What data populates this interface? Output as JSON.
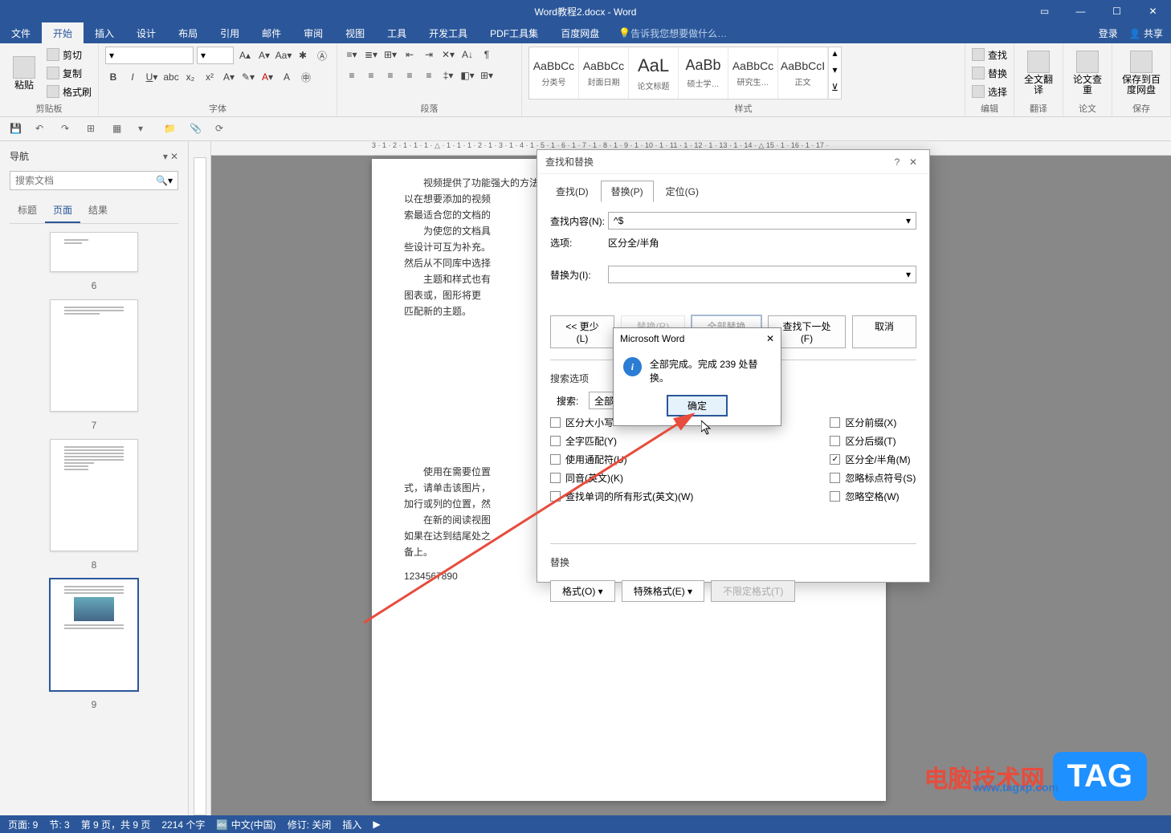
{
  "title": "Word教程2.docx - Word",
  "menu": {
    "file": "文件",
    "home": "开始",
    "insert": "插入",
    "design": "设计",
    "layout": "布局",
    "references": "引用",
    "mailings": "邮件",
    "review": "审阅",
    "view": "视图",
    "tools": "工具",
    "developer": "开发工具",
    "pdf": "PDF工具集",
    "baidu": "百度网盘",
    "tell": "告诉我您想要做什么…",
    "login": "登录",
    "share": "共享"
  },
  "ribbon": {
    "clipboard": {
      "paste": "粘贴",
      "cut": "剪切",
      "copy": "复制",
      "formatpainter": "格式刷",
      "label": "剪贴板"
    },
    "font": {
      "label": "字体"
    },
    "paragraph": {
      "label": "段落"
    },
    "styles": {
      "label": "样式",
      "items": [
        {
          "preview": "AaBbCc",
          "name": "分类号"
        },
        {
          "preview": "AaBbCc",
          "name": "封面日期"
        },
        {
          "preview": "AaL",
          "name": "论文标题"
        },
        {
          "preview": "AaBb",
          "name": "硕士学…"
        },
        {
          "preview": "AaBbCc",
          "name": "研究生…"
        },
        {
          "preview": "AaBbCcI",
          "name": "正文"
        }
      ]
    },
    "editing": {
      "find": "查找",
      "replace": "替换",
      "select": "选择",
      "label": "编辑"
    },
    "translate": {
      "full": "全文翻译",
      "label": "翻译"
    },
    "paper": {
      "btn": "论文查重",
      "label": "论文"
    },
    "save": {
      "btn": "保存到百度网盘",
      "label": "保存"
    }
  },
  "nav": {
    "title": "导航",
    "searchPlaceholder": "搜索文档",
    "tabs": {
      "headings": "标题",
      "pages": "页面",
      "results": "结果"
    },
    "thumbs": [
      "6",
      "7",
      "8",
      "9"
    ]
  },
  "doc": {
    "p1": "视频提供了功能强大的方法帮助您证明您的观点。当您单击联机视频时，可",
    "p2": "以在想要添加的视频",
    "p3": "索最适合您的文档的",
    "p4": "为使您的文档具",
    "p5": "些设计可互为补充。",
    "p6": "然后从不同库中选择",
    "p7": "主题和样式也有",
    "p8": "图表或，图形将更",
    "p9": "匹配新的主题。",
    "p10": "使用在需要位置",
    "p11": "式，请单击该图片，",
    "p12": "加行或列的位置，然",
    "p13": "在新的阅读视图",
    "p14": "如果在达到结尾处之",
    "p15": "备上。",
    "p16": "1234567890"
  },
  "dialog": {
    "title": "查找和替换",
    "tabs": {
      "find": "查找(D)",
      "replace": "替换(P)",
      "goto": "定位(G)"
    },
    "findLabel": "查找内容(N):",
    "findValue": "^$",
    "optionsLabel": "选项:",
    "optionsValue": "区分全/半角",
    "replaceLabel": "替换为(I):",
    "replaceValue": "",
    "less": "<< 更少(L)",
    "replaceBtn": "替换(R)",
    "replaceAll": "全部替换(A)",
    "findNext": "查找下一处(F)",
    "cancel": "取消",
    "searchOptions": "搜索选项",
    "searchLabel": "搜索:",
    "searchValue": "全部",
    "checks": {
      "left": [
        "区分大小写",
        "全字匹配(Y)",
        "使用通配符(U)",
        "同音(英文)(K)",
        "查找单词的所有形式(英文)(W)"
      ],
      "right": [
        "区分前缀(X)",
        "区分后缀(T)",
        "区分全/半角(M)",
        "忽略标点符号(S)",
        "忽略空格(W)"
      ]
    },
    "checkedRight": 2,
    "replaceSection": "替换",
    "format": "格式(O)",
    "special": "特殊格式(E)",
    "noformat": "不限定格式(T)"
  },
  "msgbox": {
    "title": "Microsoft Word",
    "text": "全部完成。完成 239 处替换。",
    "ok": "确定"
  },
  "status": {
    "page": "页面: 9",
    "section": "节: 3",
    "pages": "第 9 页，共 9 页",
    "words": "2214 个字",
    "lang": "中文(中国)",
    "track": "修订: 关闭",
    "insert": "插入"
  },
  "ruler": "3 · 1 · 2 · 1 · 1 · 1 · △ · 1 · 1 · 1 · 2 · 1 · 3 · 1 · 4 · 1 · 5 · 1 · 6 · 1 · 7 · 1 · 8 · 1 · 9 · 1 · 10 · 1 · 11 · 1 · 12 · 1 · 13 · 1 · 14 · △ 15 · 1 · 16 · 1 · 17 ·",
  "watermark": {
    "cn": "电脑技术网",
    "url": "www.tagxp.com",
    "tag": "TAG"
  }
}
